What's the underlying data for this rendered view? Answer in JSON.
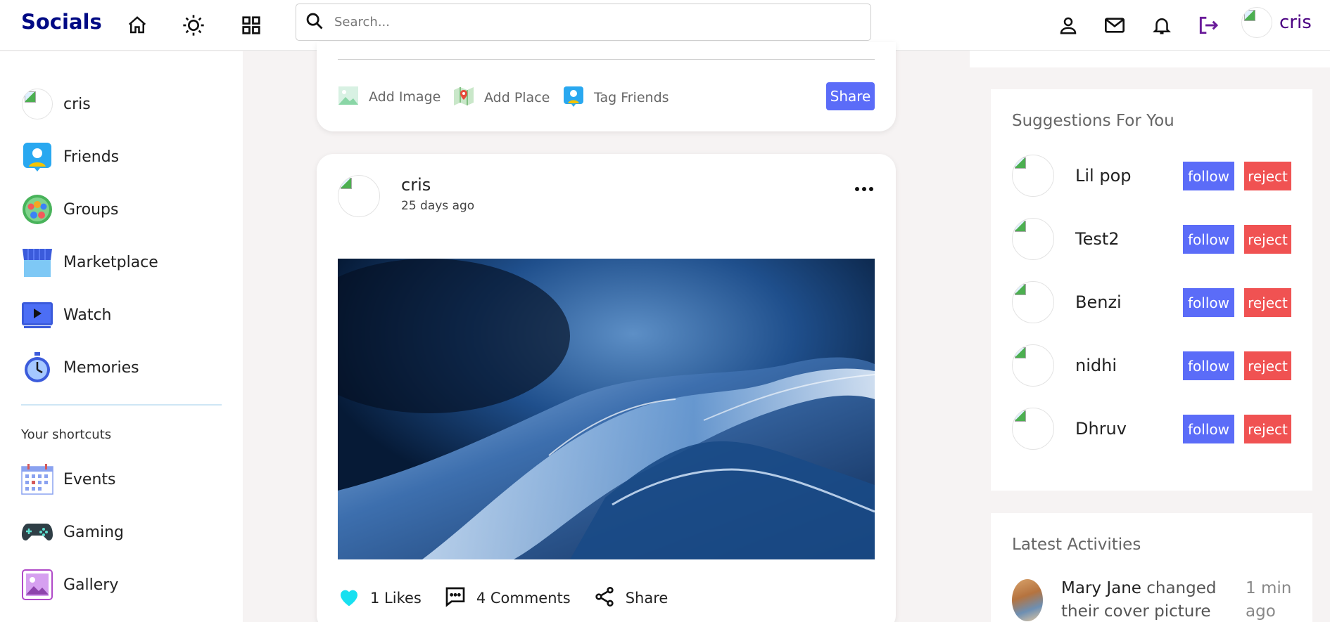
{
  "navbar": {
    "logo": "Socials",
    "search_placeholder": "Search...",
    "user_name": "cris",
    "accent_color": "#000a84"
  },
  "sidebar": {
    "items": [
      {
        "label": "cris",
        "icon": "avatar"
      },
      {
        "label": "Friends",
        "icon": "friends-icon"
      },
      {
        "label": "Groups",
        "icon": "groups-icon"
      },
      {
        "label": "Marketplace",
        "icon": "marketplace-icon"
      },
      {
        "label": "Watch",
        "icon": "watch-icon"
      },
      {
        "label": "Memories",
        "icon": "memories-icon"
      }
    ],
    "shortcuts_title": "Your shortcuts",
    "shortcuts": [
      {
        "label": "Events",
        "icon": "calendar-icon"
      },
      {
        "label": "Gaming",
        "icon": "gamepad-icon"
      },
      {
        "label": "Gallery",
        "icon": "gallery-icon"
      }
    ]
  },
  "share_box": {
    "add_image": "Add Image",
    "add_place": "Add Place",
    "tag_friends": "Tag Friends",
    "share_button": "Share"
  },
  "post": {
    "user": "cris",
    "time": "25 days ago",
    "likes": "1 Likes",
    "comments": "4 Comments",
    "share": "Share"
  },
  "suggestions": {
    "title": "Suggestions For You",
    "follow_label": "follow",
    "reject_label": "reject",
    "users": [
      "Lil pop",
      "Test2",
      "Benzi",
      "nidhi",
      "Dhruv"
    ]
  },
  "activities": {
    "title": "Latest Activities",
    "items": [
      {
        "name": "Mary Jane",
        "action": " changed their cover picture",
        "time": "1 min ago"
      }
    ]
  }
}
